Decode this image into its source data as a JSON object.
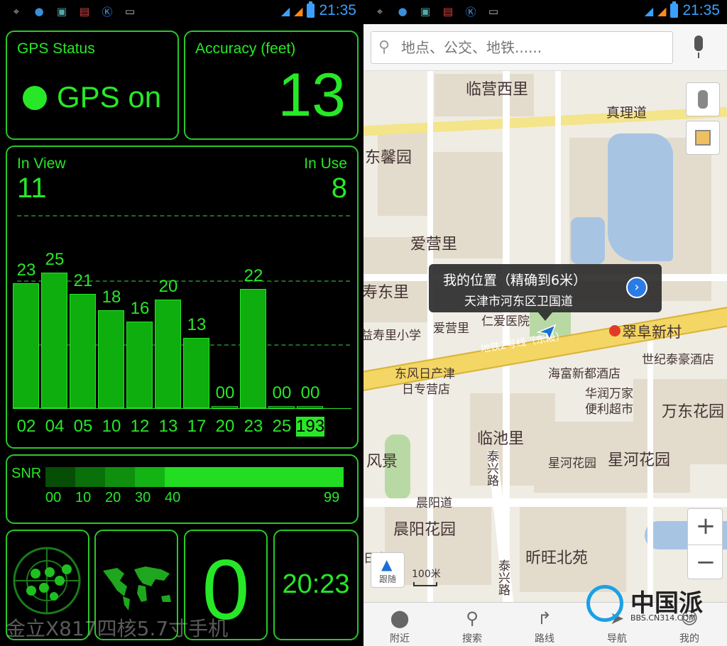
{
  "statusbar": {
    "time": "21:35"
  },
  "gps": {
    "status_title": "GPS Status",
    "status_value": "GPS on",
    "accuracy_title": "Accuracy (feet)",
    "accuracy_value": "13",
    "in_view_label": "In View",
    "in_view_value": "11",
    "in_use_label": "In Use",
    "in_use_value": "8",
    "satellites": [
      {
        "prn": "02",
        "snr": "23",
        "level": 23
      },
      {
        "prn": "04",
        "snr": "25",
        "level": 25
      },
      {
        "prn": "05",
        "snr": "21",
        "level": 21
      },
      {
        "prn": "10",
        "snr": "18",
        "level": 18
      },
      {
        "prn": "12",
        "snr": "16",
        "level": 16
      },
      {
        "prn": "13",
        "snr": "20",
        "level": 20
      },
      {
        "prn": "17",
        "snr": "13",
        "level": 13
      },
      {
        "prn": "20",
        "snr": "00",
        "level": 0
      },
      {
        "prn": "23",
        "snr": "22",
        "level": 22
      },
      {
        "prn": "25",
        "snr": "00",
        "level": 0
      },
      {
        "prn": "193",
        "snr": "00",
        "level": 0
      }
    ],
    "snr_label": "SNR",
    "snr_scale": [
      "00",
      "10",
      "20",
      "30",
      "40",
      "99"
    ],
    "time_display": "20:23",
    "big_digit": "0",
    "watermark": "金立X817四核5.7寸手机"
  },
  "map": {
    "search_placeholder": "地点、公交、地铁......",
    "popup_title": "我的位置（精确到6米）",
    "popup_subtitle": "天津市河东区卫国道",
    "scale_label": "100米",
    "follow_label": "跟随",
    "labels": {
      "linyingxili": "临营西里",
      "zhenlidao": "真理道",
      "dongxinyuan": "东馨园",
      "aiyingli": "爱营里",
      "shoudongli": "寿东里",
      "renaiyiyuan": "仁爱医院",
      "aiyingli2": "爱营里",
      "shouli_school": "益寿里小学",
      "cuifuxincun": "翠阜新村",
      "subway": "地铁2号线（东段）",
      "shijitaihao": "世纪泰豪酒店",
      "dongfengriche": "东风日产津",
      "rizhuanying": "日专营店",
      "haifu": "海富新都酒店",
      "huarun1": "华润万家",
      "huarun2": "便利超市",
      "wandong": "万东花园",
      "linchili": "临池里",
      "fengjing": "风景",
      "taixinglu": "泰兴路",
      "xinghe_small": "星河花园",
      "xinghe_big": "星河花园",
      "chenyangdao": "晨阳道",
      "chenyang_garden": "晨阳花园",
      "xinwang": "昕旺北苑",
      "taixinglu2": "泰兴路",
      "rijin": "日吉"
    },
    "zoom_in": "+",
    "zoom_out": "−",
    "tabs": [
      "附近",
      "搜索",
      "路线",
      "导航",
      "我的"
    ],
    "brand_text": "中国派",
    "brand_url": "BBS.CN314.COM"
  }
}
